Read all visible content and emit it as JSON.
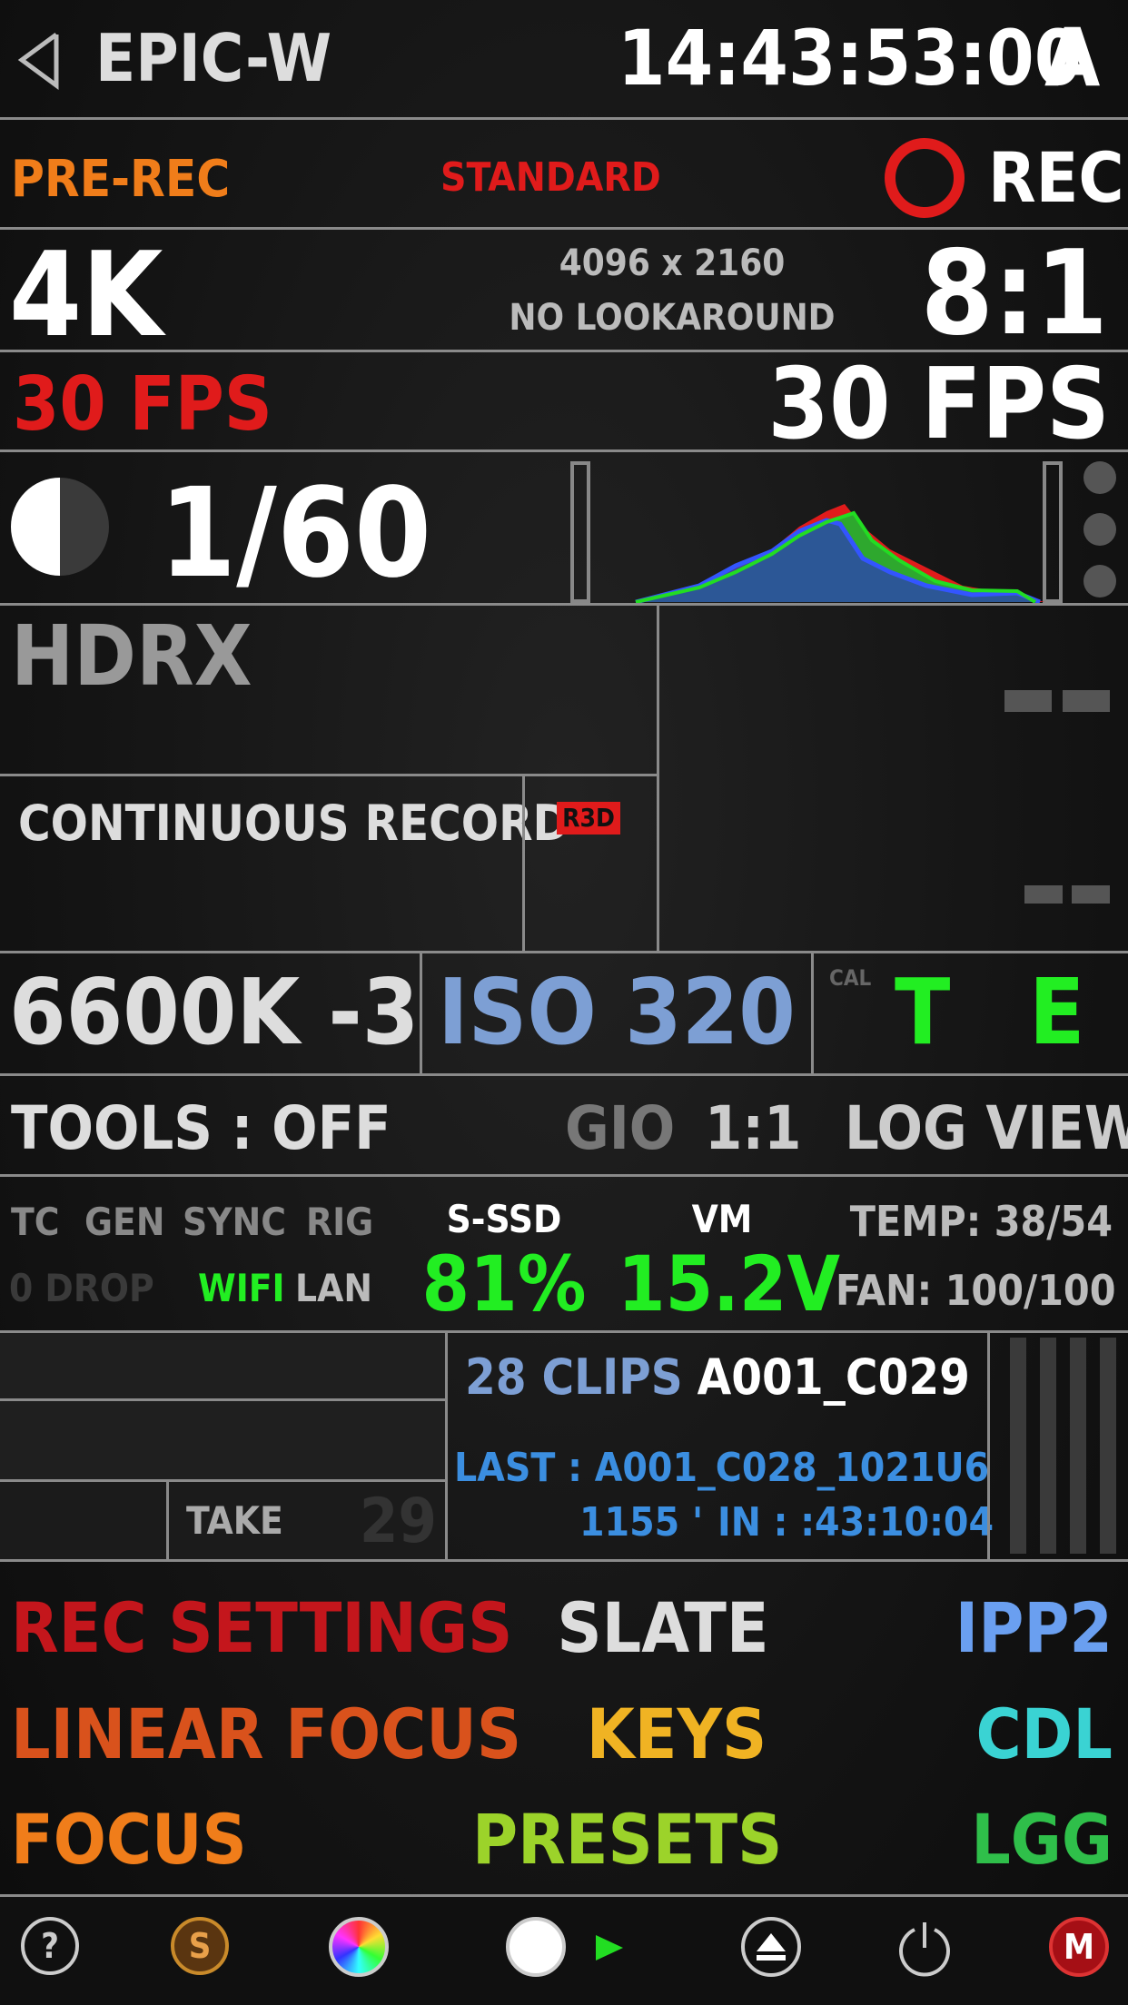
{
  "header": {
    "camera": "EPIC-W",
    "timecode": "14:43:53:00",
    "slot": "A"
  },
  "status": {
    "prerec": "PRE-REC",
    "mode": "STANDARD",
    "rec": "REC"
  },
  "resolution": {
    "format": "4K",
    "dims": "4096 x 2160",
    "lookaround": "NO LOOKAROUND",
    "compression": "8:1"
  },
  "fps": {
    "project": "30 FPS",
    "record": "30 FPS"
  },
  "shutter": {
    "value": "1/60"
  },
  "hdrx": {
    "label": "HDRX",
    "placeholder": "——"
  },
  "record_mode": {
    "label": "CONTINUOUS RECORD",
    "codec": "R3D",
    "placeholder": "——"
  },
  "color": {
    "wb": "6600K -3",
    "iso": "ISO 320",
    "cal": "CAL",
    "t": "T",
    "e": "E"
  },
  "tools": {
    "label": "TOOLS : OFF",
    "gio": "GIO",
    "ratio": "1:1",
    "view": "LOG VIEW"
  },
  "sync": {
    "tc": "TC",
    "gen": "GEN",
    "sync": "SYNC",
    "rig": "RIG",
    "drop": "0 DROP",
    "wifi": "WIFI",
    "lan": "LAN",
    "ssd_label": "S-SSD",
    "ssd_value": "81%",
    "vm_label": "VM",
    "vm_value": "15.2V",
    "temp": "TEMP: 38/54",
    "fan": "FAN: 100/100"
  },
  "clips": {
    "take_label": "TAKE",
    "take_num": "29",
    "count": "28 CLIPS",
    "current": "A001_C029",
    "last": "LAST : A001_C028_1021U6",
    "last_dur": "1155 '",
    "last_in": "IN : :43:10:04"
  },
  "menu": {
    "rec_settings": "REC SETTINGS",
    "slate": "SLATE",
    "ipp2": "IPP2",
    "linear_focus": "LINEAR FOCUS",
    "keys": "KEYS",
    "cdl": "CDL",
    "focus": "FOCUS",
    "presets": "PRESETS",
    "lgg": "LGG"
  },
  "bottom_bar": {
    "help": "?",
    "s": "S",
    "m": "M"
  },
  "colors": {
    "orange": "#f07d1a",
    "red": "#e01b1b",
    "green": "#22ee22",
    "blue": "#7d9fd4",
    "accent_blue": "#3b8ee0",
    "teal": "#3ad3d3",
    "yellow": "#f0b323",
    "lime": "#9cd32a",
    "lgg_green": "#2fbf4a"
  },
  "icons": [
    "back-arrow-icon",
    "record-ring-icon",
    "shutter-half-icon",
    "histogram-icon",
    "help-icon",
    "s-icon",
    "color-wheel-icon",
    "circle-icon",
    "play-icon",
    "eject-icon",
    "power-icon",
    "m-icon"
  ]
}
